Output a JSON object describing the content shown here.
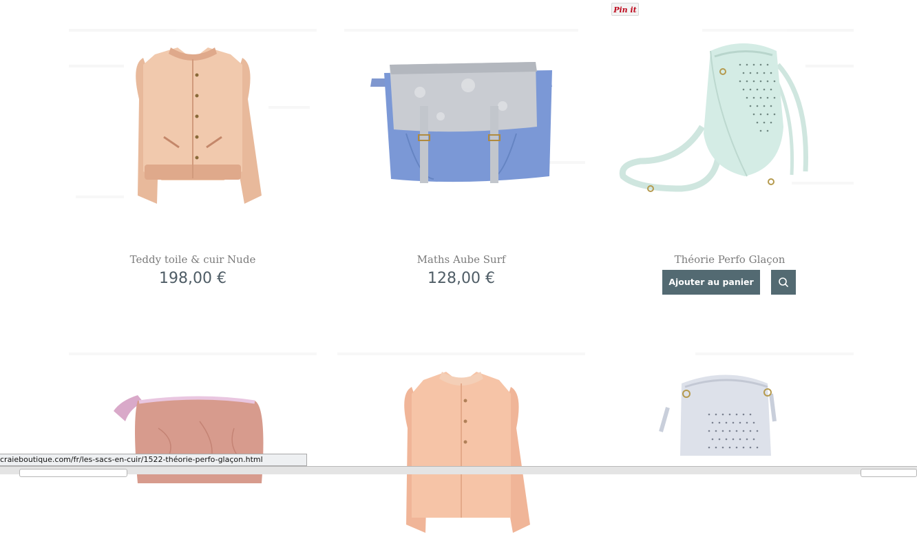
{
  "pinterest": {
    "label": "Pin it"
  },
  "products": [
    {
      "name": "Teddy toile & cuir Nude",
      "price": "198,00 €"
    },
    {
      "name": "Maths Aube Surf",
      "price": "128,00 €"
    },
    {
      "name": "Théorie Perfo Glaçon",
      "cart_label": "Ajouter au panier"
    }
  ],
  "status": {
    "url": "craieboutique.com/fr/les-sacs-en-cuir/1522-théorie-perfo-glaçon.html"
  }
}
